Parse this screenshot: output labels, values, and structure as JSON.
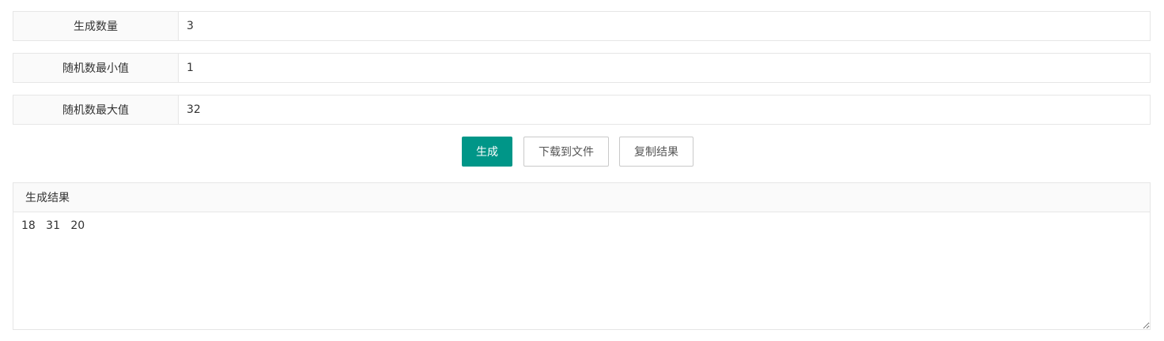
{
  "form": {
    "count": {
      "label": "生成数量",
      "value": "3"
    },
    "min": {
      "label": "随机数最小值",
      "value": "1"
    },
    "max": {
      "label": "随机数最大值",
      "value": "32"
    }
  },
  "actions": {
    "generate_label": "生成",
    "download_label": "下载到文件",
    "copy_label": "复制结果"
  },
  "result": {
    "title": "生成结果",
    "text": "18   31   20"
  },
  "colors": {
    "primary": "#009688",
    "border": "#e6e6e6",
    "label_bg": "#fafafa"
  }
}
